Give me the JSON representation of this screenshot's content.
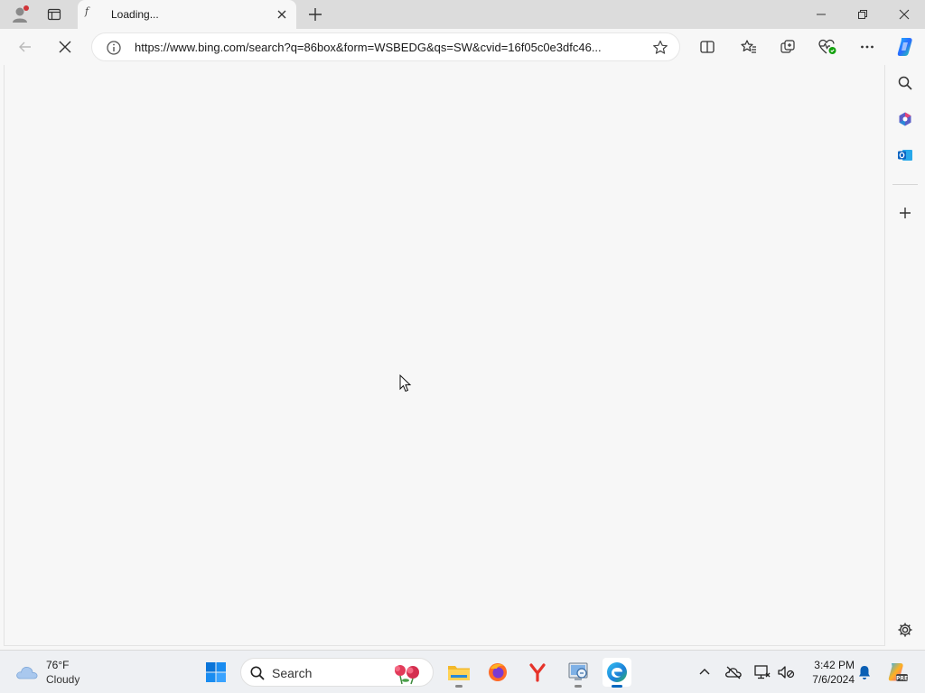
{
  "browser": {
    "tab_title": "Loading...",
    "favicon_glyph": "f",
    "address_url": "https://www.bing.com/search?q=86box&form=WSBEDG&qs=SW&cvid=16f05c0e3dfc46...",
    "accent_color": "#0067c0"
  },
  "taskbar": {
    "weather_temp": "76°F",
    "weather_condition": "Cloudy",
    "search_label": "Search",
    "clock_time": "3:42 PM",
    "clock_date": "7/6/2024"
  }
}
